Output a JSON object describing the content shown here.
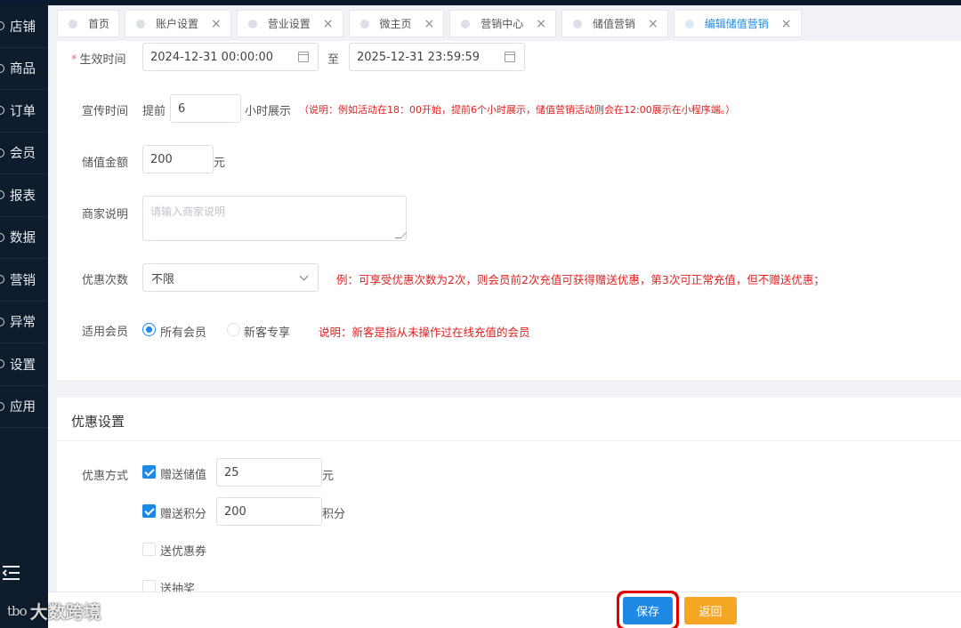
{
  "sidebar": {
    "items": [
      {
        "label": "店铺"
      },
      {
        "label": "商品"
      },
      {
        "label": "订单"
      },
      {
        "label": "会员"
      },
      {
        "label": "报表"
      },
      {
        "label": "数据"
      },
      {
        "label": "营销"
      },
      {
        "label": "异常"
      },
      {
        "label": "设置"
      },
      {
        "label": "应用"
      }
    ]
  },
  "watermark": {
    "logo": "tbo",
    "text": "大数跨境"
  },
  "tabs": [
    {
      "label": "首页",
      "closable": false
    },
    {
      "label": "账户设置",
      "closable": true
    },
    {
      "label": "营业设置",
      "closable": true
    },
    {
      "label": "微主页",
      "closable": true
    },
    {
      "label": "营销中心",
      "closable": true
    },
    {
      "label": "储值营销",
      "closable": true
    },
    {
      "label": "编辑储值营销",
      "closable": true,
      "active": true
    }
  ],
  "form": {
    "effective_time": {
      "label": "生效时间",
      "start": "2024-12-31 00:00:00",
      "sep": "至",
      "end": "2025-12-31 23:59:59"
    },
    "promo_time": {
      "label": "宣传时间",
      "prefix": "提前",
      "value": "6",
      "suffix": "小时展示",
      "note": "（说明：例如活动在18：00开始，提前6个小时展示，储值营销活动则会在12:00展示在小程序端。）"
    },
    "amount": {
      "label": "储值金额",
      "value": "200",
      "unit": "元"
    },
    "merchant_note": {
      "label": "商家说明",
      "placeholder": "请输入商家说明"
    },
    "discount_count": {
      "label": "优惠次数",
      "value": "不限",
      "note": "例：可享受优惠次数为2次，则会员前2次充值可获得赠送优惠，第3次可正常充值，但不赠送优惠；"
    },
    "members": {
      "label": "适用会员",
      "option_all": "所有会员",
      "option_new": "新客专享",
      "note": "说明：新客是指从未操作过在线充值的会员"
    }
  },
  "discount": {
    "title": "优惠设置",
    "method_label": "优惠方式",
    "gift_balance": {
      "label": "赠送储值",
      "value": "25",
      "unit": "元",
      "checked": true
    },
    "gift_points": {
      "label": "赠送积分",
      "value": "200",
      "unit": "积分",
      "checked": true
    },
    "coupon": {
      "label": "送优惠券",
      "checked": false
    },
    "lottery": {
      "label": "送抽奖",
      "checked": false
    }
  },
  "footer": {
    "save": "保存",
    "back": "返回"
  },
  "colors": {
    "primary": "#1e88e5",
    "warning": "#f5a623",
    "danger": "#e02020",
    "sidebar": "#0f1c2e"
  }
}
